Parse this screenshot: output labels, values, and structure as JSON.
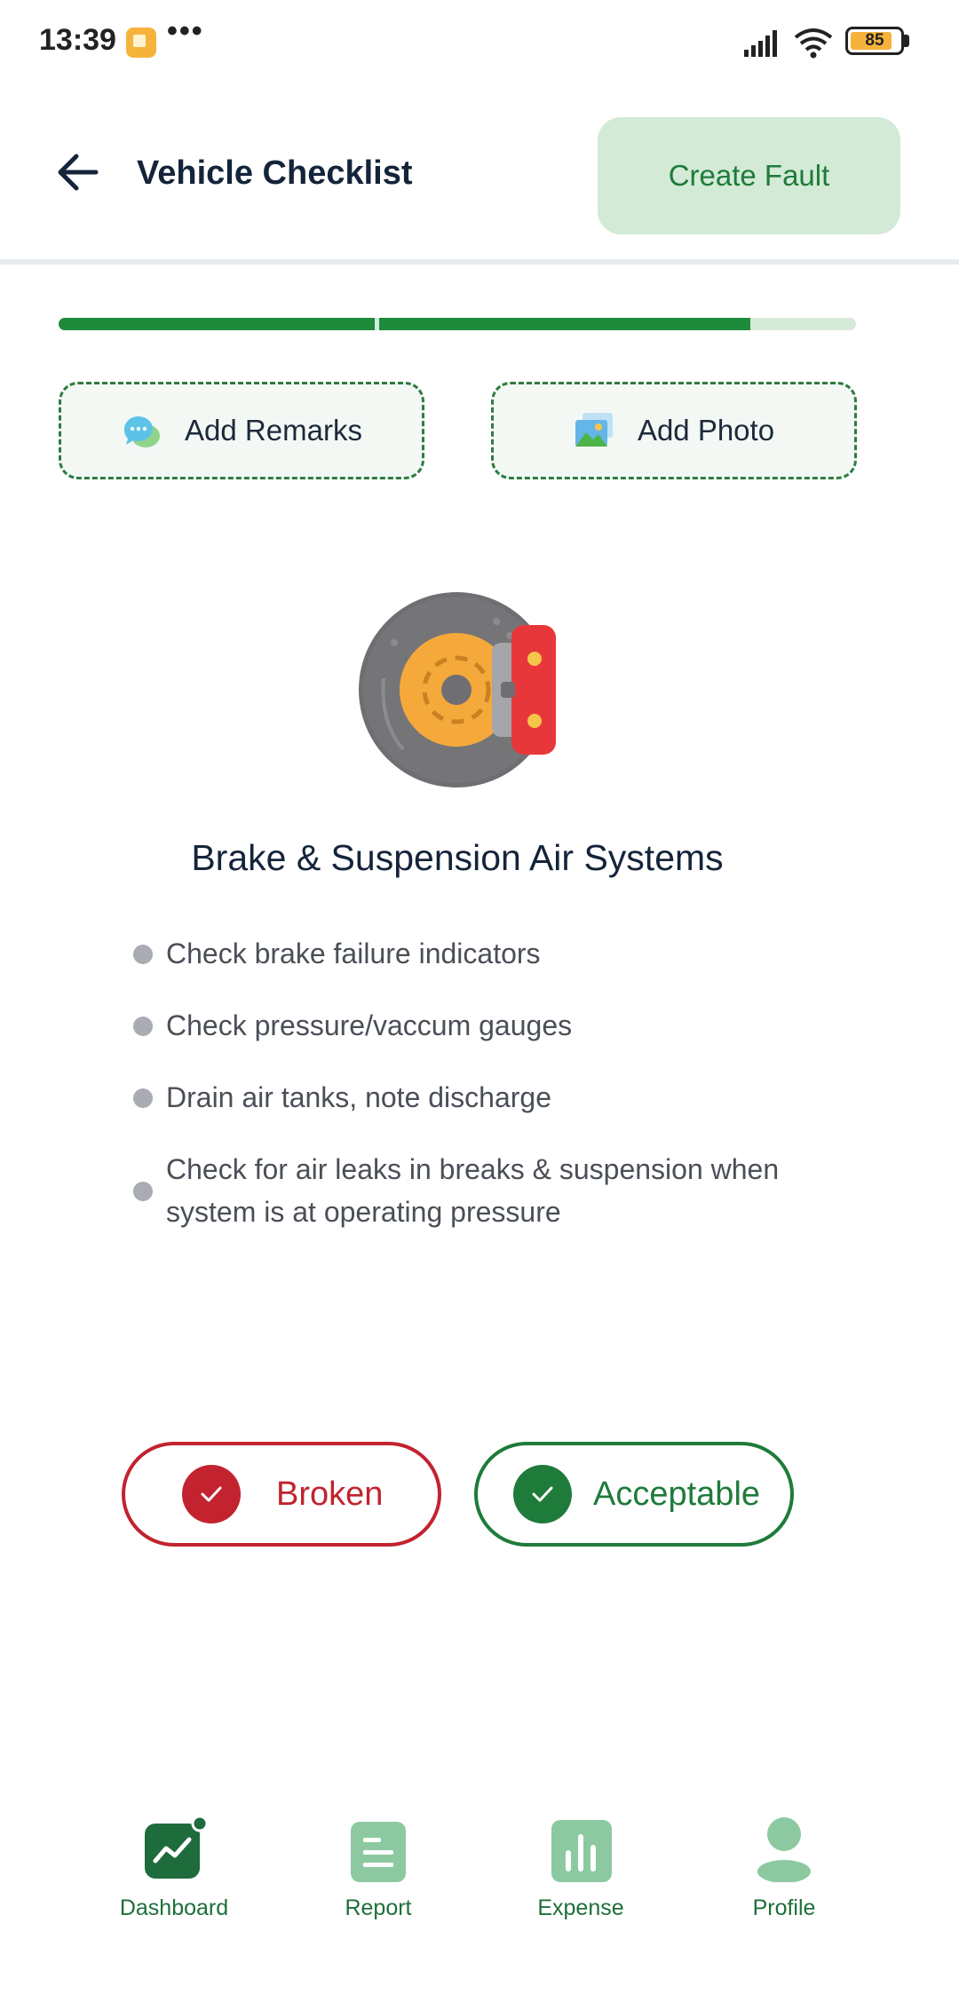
{
  "status_bar": {
    "time": "13:39",
    "dots": "•••",
    "battery_level": "85"
  },
  "header": {
    "title": "Vehicle Checklist",
    "create_fault_label": "Create Fault"
  },
  "progress": {
    "segments": 2,
    "filled_fraction": 0.87
  },
  "actions": {
    "add_remarks_label": "Add Remarks",
    "add_photo_label": "Add Photo"
  },
  "section": {
    "title": "Brake & Suspension Air Systems",
    "items": [
      "Check brake failure indicators",
      "Check pressure/vaccum gauges",
      "Drain air tanks, note discharge",
      "Check for air leaks in breaks & suspension when system is at operating pressure"
    ]
  },
  "choices": {
    "broken_label": "Broken",
    "acceptable_label": "Acceptable"
  },
  "nav": {
    "dashboard": "Dashboard",
    "report": "Report",
    "expense": "Expense",
    "profile": "Profile"
  },
  "colors": {
    "primary_green": "#1e7b3a",
    "light_green": "#d3ead6",
    "danger_red": "#c2232f",
    "title_navy": "#14243a"
  }
}
